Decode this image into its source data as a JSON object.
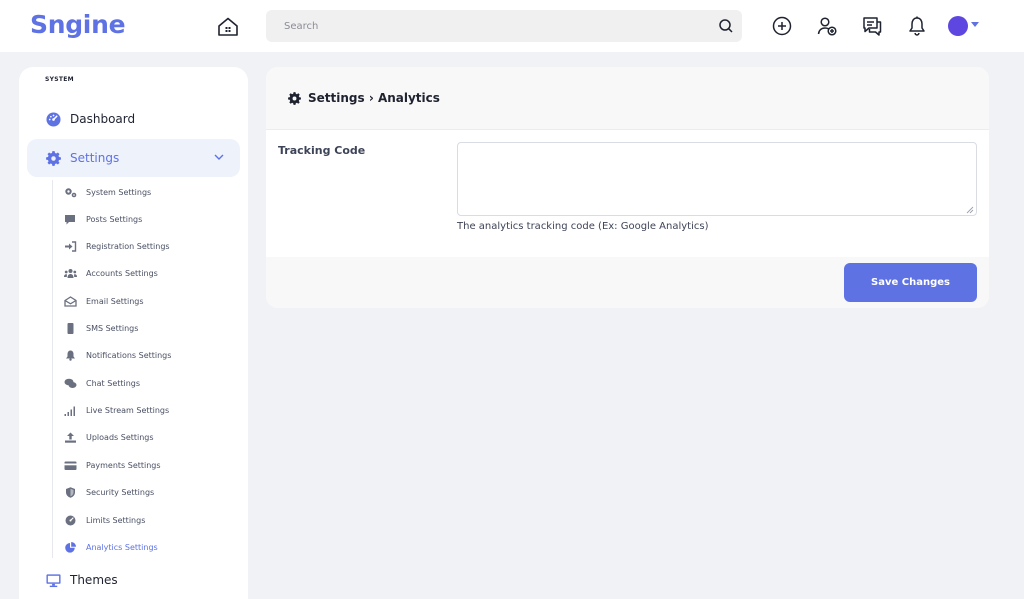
{
  "header": {
    "logo": "Sngine",
    "search_placeholder": "Search",
    "icons": [
      "home-icon",
      "search-icon",
      "add-circle-icon",
      "friend-request-icon",
      "messages-icon",
      "bell-icon",
      "avatar",
      "caret-down-icon"
    ]
  },
  "sidebar": {
    "section_title": "SYSTEM",
    "dashboard_label": "Dashboard",
    "settings_label": "Settings",
    "themes_label": "Themes",
    "sub_items": [
      {
        "label": "System Settings",
        "icon": "cogs-icon"
      },
      {
        "label": "Posts Settings",
        "icon": "comment-icon"
      },
      {
        "label": "Registration Settings",
        "icon": "sign-in-icon"
      },
      {
        "label": "Accounts Settings",
        "icon": "users-icon"
      },
      {
        "label": "Email Settings",
        "icon": "envelope-open-icon"
      },
      {
        "label": "SMS Settings",
        "icon": "mobile-icon"
      },
      {
        "label": "Notifications Settings",
        "icon": "bell-icon"
      },
      {
        "label": "Chat Settings",
        "icon": "comments-icon"
      },
      {
        "label": "Live Stream Settings",
        "icon": "signal-icon"
      },
      {
        "label": "Uploads Settings",
        "icon": "upload-icon"
      },
      {
        "label": "Payments Settings",
        "icon": "credit-card-icon"
      },
      {
        "label": "Security Settings",
        "icon": "shield-icon"
      },
      {
        "label": "Limits Settings",
        "icon": "gauge-icon"
      },
      {
        "label": "Analytics Settings",
        "icon": "pie-chart-icon",
        "active": true
      }
    ]
  },
  "main": {
    "title": "Settings › Analytics",
    "field_label": "Tracking Code",
    "field_value": "",
    "help_text": "The analytics tracking code (Ex: Google Analytics)",
    "save_label": "Save Changes"
  },
  "colors": {
    "accent": "#5e72e4",
    "page_bg": "#f0f2f5",
    "card_header_bg": "#f8f8f8"
  }
}
